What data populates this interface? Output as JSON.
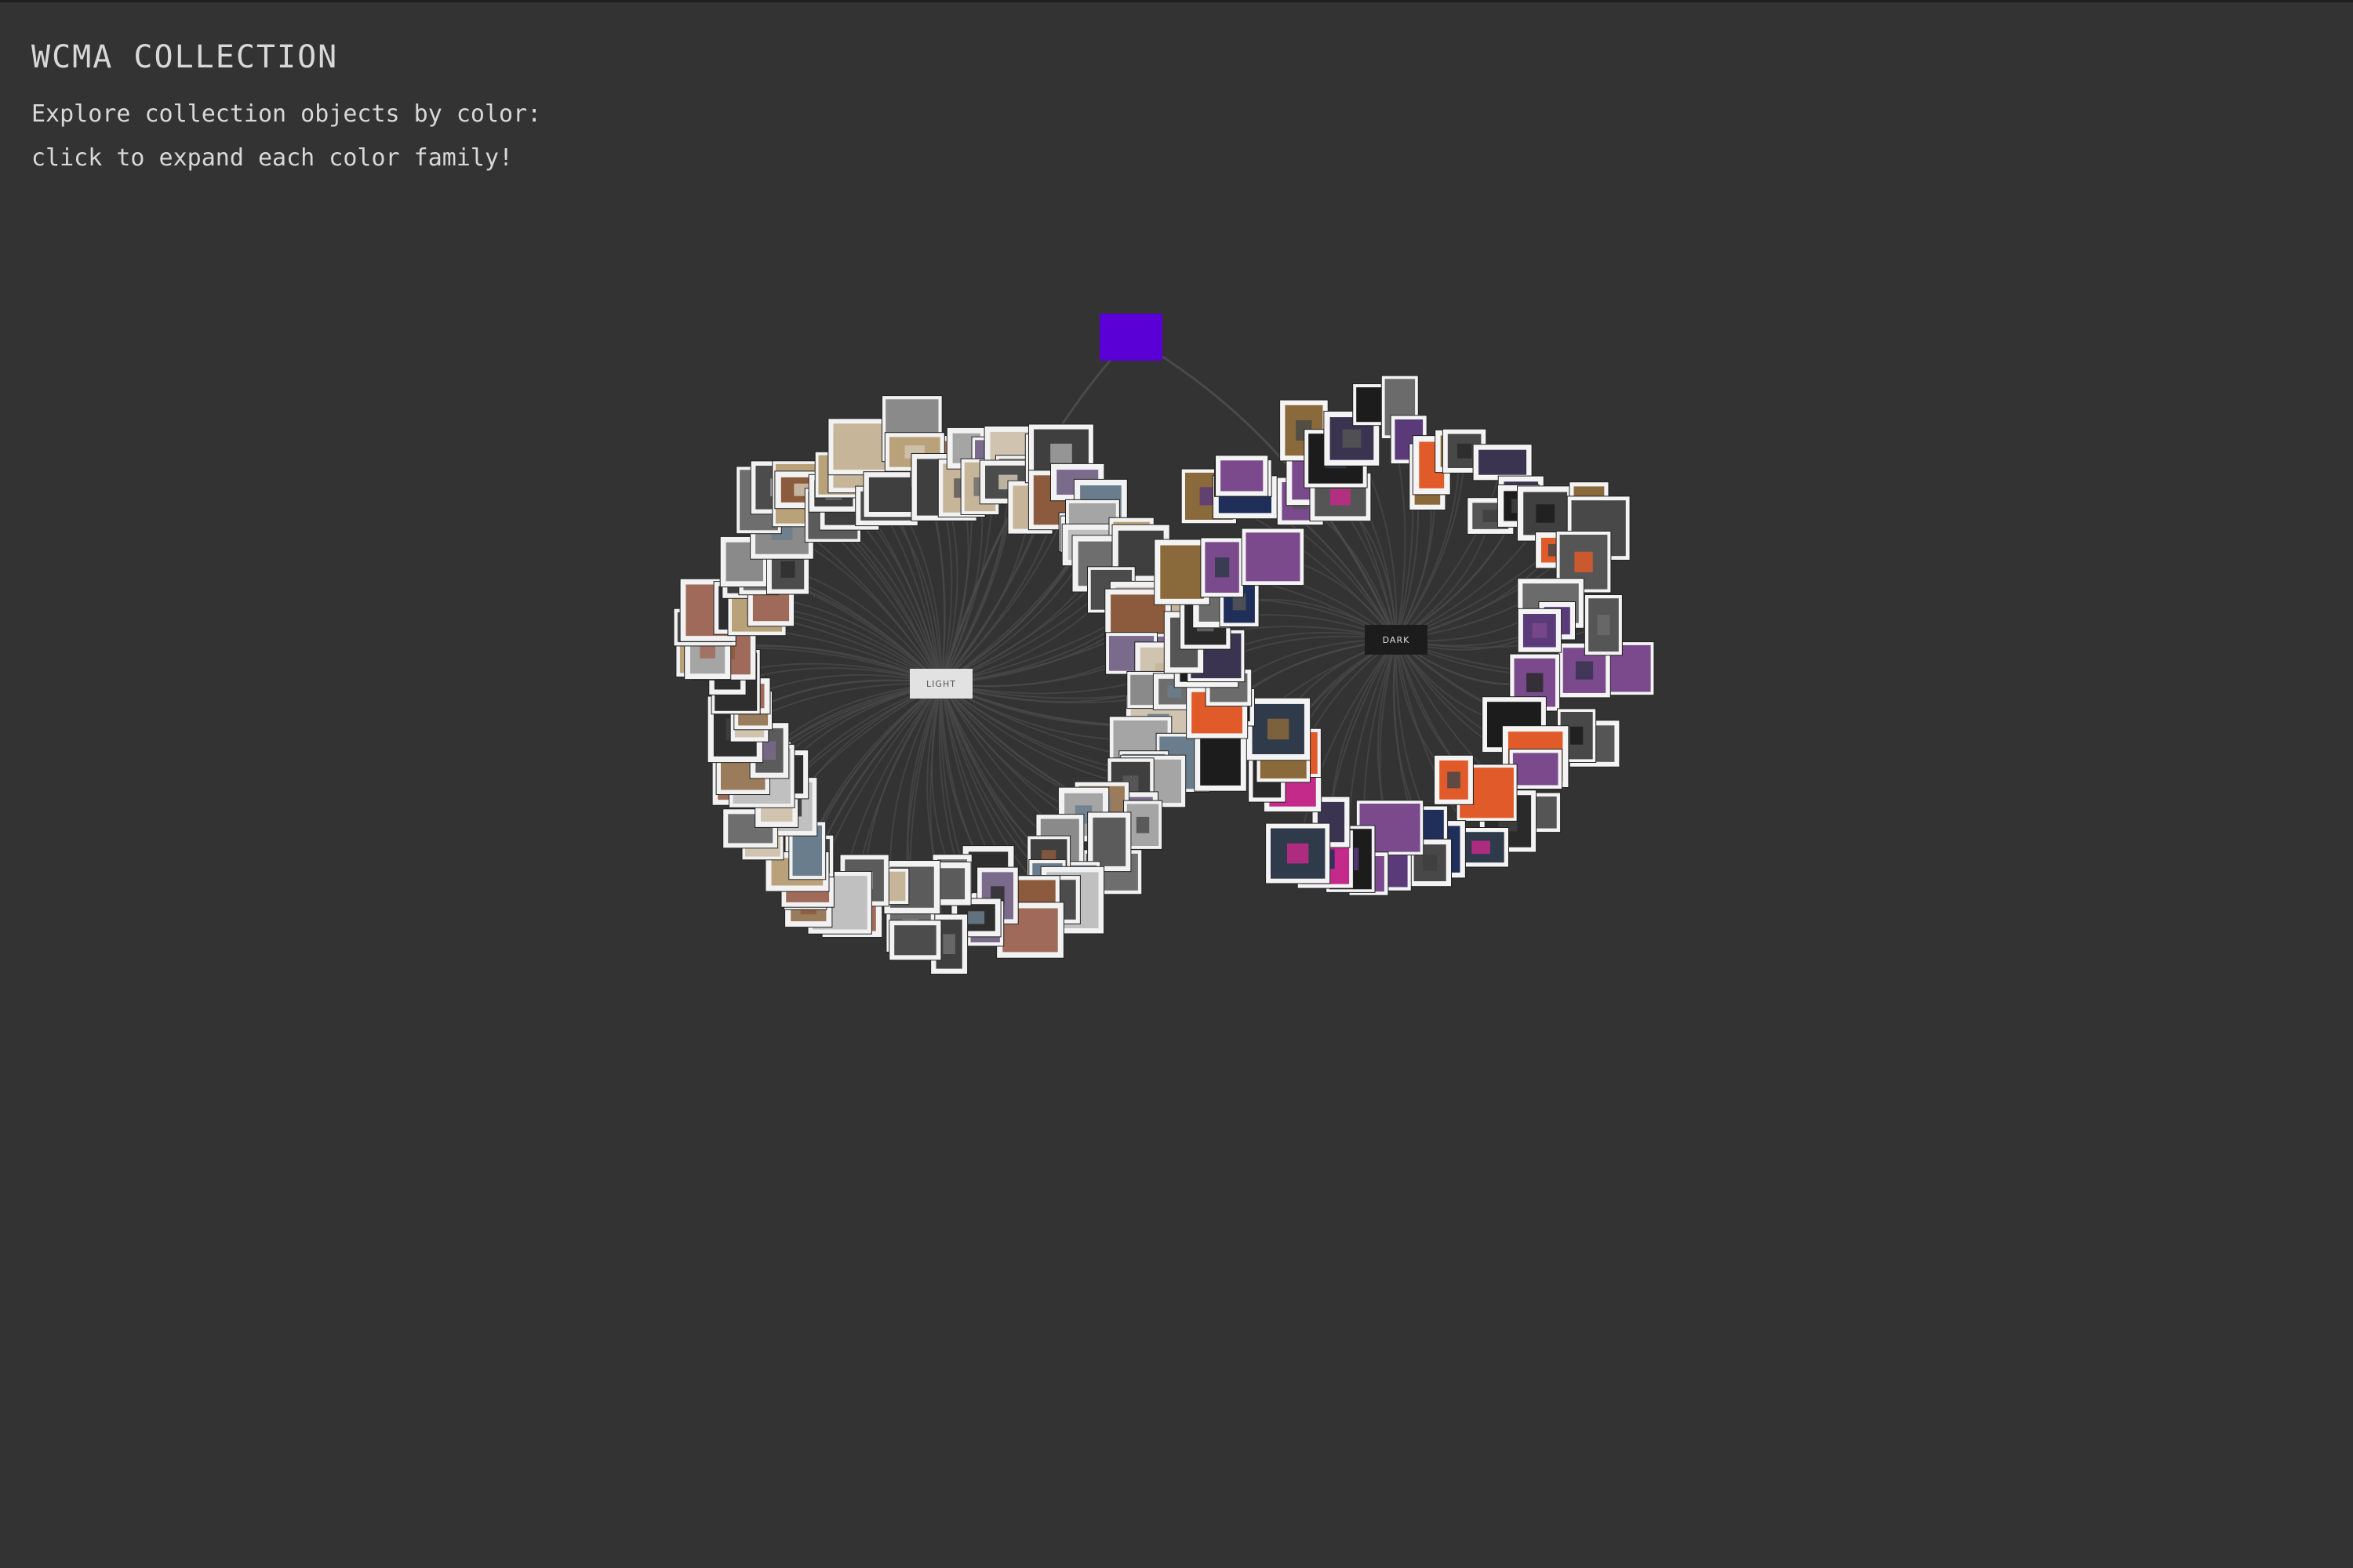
{
  "header": {
    "title": "WCMA COLLECTION",
    "subtitle_line1": "Explore collection objects by color:",
    "subtitle_line2": "click to expand each color family!"
  },
  "root_node": {
    "color": "#5a00d6"
  },
  "clusters": [
    {
      "name": "light",
      "label": "LIGHT",
      "hub_color": "#e2e2e2",
      "text_color": "#555555",
      "frame_color": "#f2f2f2",
      "object_count": 118
    },
    {
      "name": "dark",
      "label": "DARK",
      "hub_color": "#1c1c1c",
      "text_color": "#dddddd",
      "frame_color": "#f4f4f4",
      "object_count": 72
    }
  ],
  "theme": {
    "background": "#333333",
    "link_color": "#4a4a4a",
    "text_color": "#d8d8d8"
  }
}
